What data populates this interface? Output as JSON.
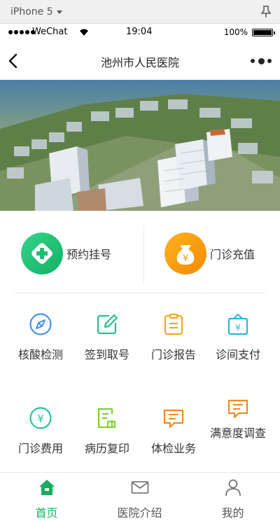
{
  "simulator": {
    "device": "iPhone 5"
  },
  "status_bar": {
    "carrier": "WeChat",
    "time": "19:04",
    "battery": "100%"
  },
  "nav": {
    "title": "池州市人民医院"
  },
  "quick_actions": [
    {
      "label": "预约挂号",
      "icon": "plus-diamond-icon",
      "color": "#1dbf73"
    },
    {
      "label": "门诊充值",
      "icon": "money-bag-icon",
      "color": "#f59a0c"
    }
  ],
  "services": [
    {
      "label": "核酸检测",
      "icon": "compass-icon",
      "color": "#4a90e2"
    },
    {
      "label": "签到取号",
      "icon": "edit-icon",
      "color": "#2bbf8a"
    },
    {
      "label": "门诊报告",
      "icon": "clipboard-icon",
      "color": "#f5a623"
    },
    {
      "label": "诊间支付",
      "icon": "payment-bag-icon",
      "color": "#2ab7d8"
    },
    {
      "label": "门诊费用",
      "icon": "yuan-circle-icon",
      "color": "#26c2a4"
    },
    {
      "label": "病历复印",
      "icon": "document-icon",
      "color": "#7ed321"
    },
    {
      "label": "体检业务",
      "icon": "chat-bubble-icon",
      "color": "#f08a24"
    },
    {
      "label": "满意度调查",
      "icon": "chat-bubble-icon",
      "color": "#f08a24"
    }
  ],
  "tabs": [
    {
      "label": "首页",
      "icon": "home-icon",
      "active": true
    },
    {
      "label": "医院介绍",
      "icon": "envelope-icon",
      "active": false
    },
    {
      "label": "我的",
      "icon": "user-icon",
      "active": false
    }
  ],
  "colors": {
    "accent": "#1aad5e",
    "text": "#333333",
    "divider": "#ececec"
  }
}
